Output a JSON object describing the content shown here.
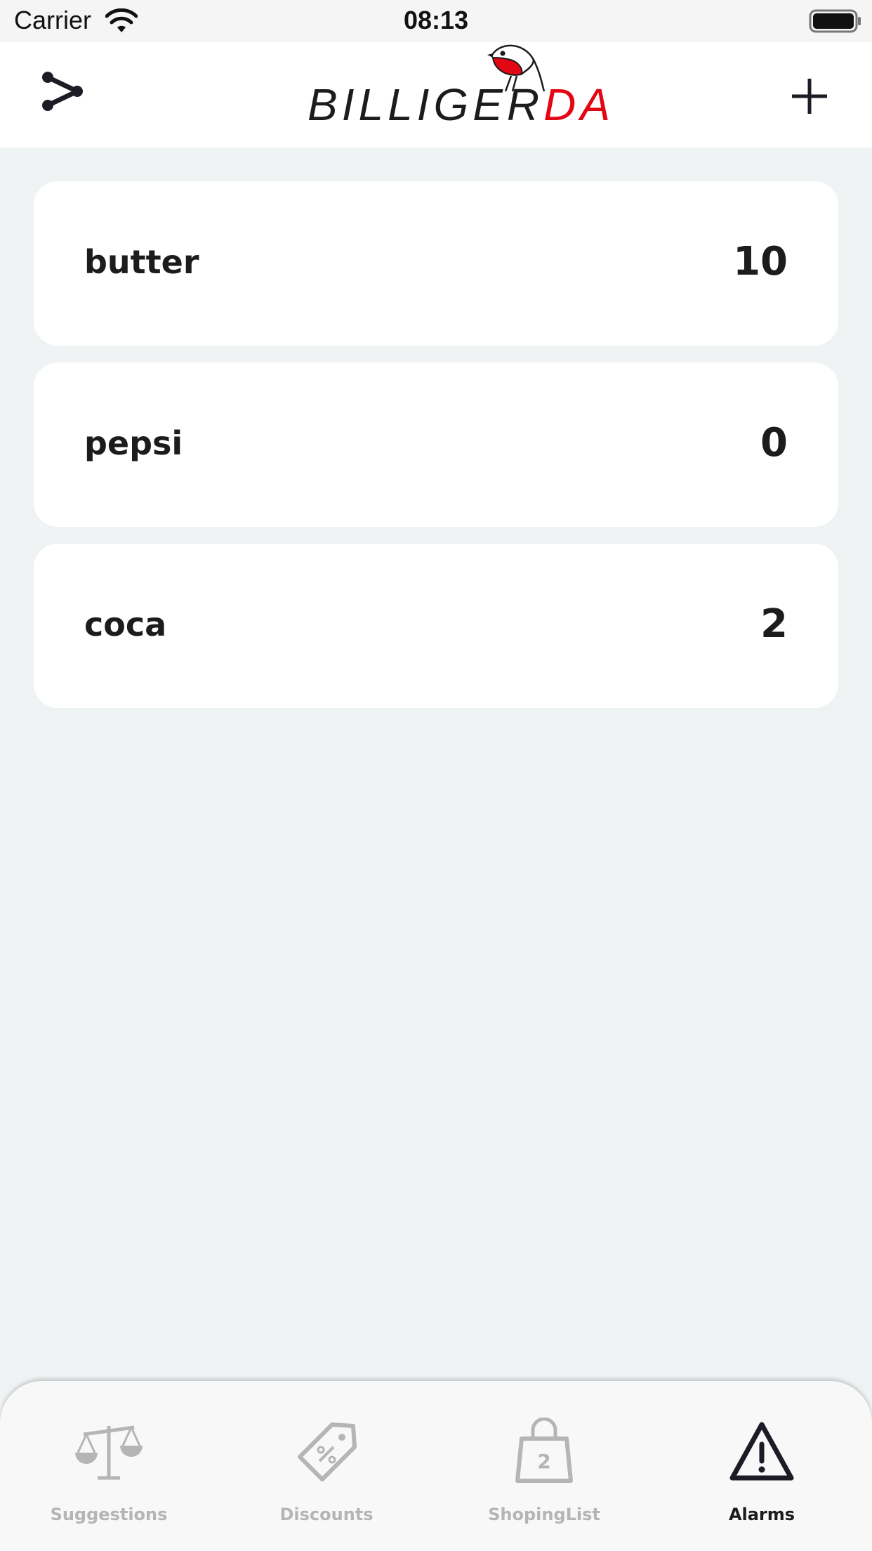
{
  "status_bar": {
    "carrier": "Carrier",
    "time": "08:13"
  },
  "header": {
    "logo_left": "BILLIGER",
    "logo_right": "DA",
    "share_icon": "share-icon",
    "add_icon": "plus-icon"
  },
  "alarms": [
    {
      "name": "butter",
      "value": "10"
    },
    {
      "name": "pepsi",
      "value": "0"
    },
    {
      "name": "coca",
      "value": "2"
    }
  ],
  "tabs": [
    {
      "label": "Suggestions",
      "icon": "scale-icon",
      "active": false
    },
    {
      "label": "Discounts",
      "icon": "discount-tag-icon",
      "active": false
    },
    {
      "label": "ShopingList",
      "icon": "shopping-bag-icon",
      "badge": "2",
      "active": false
    },
    {
      "label": "Alarms",
      "icon": "warning-icon",
      "active": true
    }
  ],
  "colors": {
    "brand_red": "#e30613",
    "text_dark": "#1d1b1b",
    "background": "#eff3f4",
    "inactive_tab": "#b5b5b5"
  }
}
